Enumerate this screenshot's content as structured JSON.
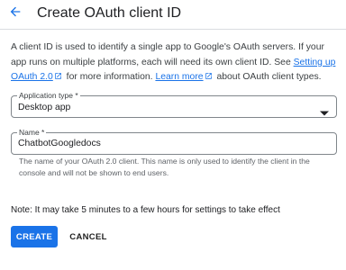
{
  "header": {
    "back_icon": "arrow-back-icon",
    "title": "Create OAuth client ID"
  },
  "description": {
    "part1": "A client ID is used to identify a single app to Google's OAuth servers. If your app runs on multiple platforms, each will need its own client ID. See ",
    "link1": "Setting up OAuth 2.0",
    "part2": " for more information. ",
    "link2": "Learn more",
    "part3": " about OAuth client types.",
    "external_icon": "open-in-new-icon"
  },
  "application_type": {
    "label": "Application type *",
    "value": "Desktop app",
    "dropdown_icon": "arrow-drop-down-icon"
  },
  "name_field": {
    "label": "Name *",
    "value": "ChatbotGoogledocs",
    "hint": "The name of your OAuth 2.0 client. This name is only used to identify the client in the console and will not be shown to end users."
  },
  "note": "Note: It may take 5 minutes to a few hours for settings to take effect",
  "actions": {
    "create_label": "CREATE",
    "cancel_label": "CANCEL"
  },
  "colors": {
    "accent": "#1a73e8",
    "text": "#202124",
    "muted": "#5f6368",
    "border": "#80868b"
  }
}
